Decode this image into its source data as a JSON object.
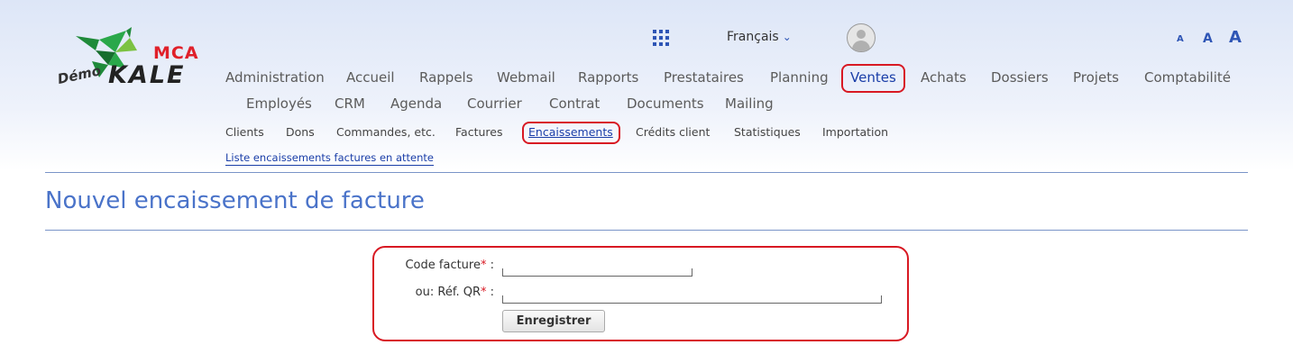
{
  "logo": {
    "brand_top": "MCA",
    "brand_main": "KALE",
    "demo": "Démo"
  },
  "header": {
    "language": "Français",
    "font_sizes": [
      "A",
      "A",
      "A"
    ]
  },
  "nav": {
    "row1": [
      "Administration",
      "Accueil",
      "Rappels",
      "Webmail",
      "Rapports",
      "Prestataires",
      "Planning",
      "Ventes",
      "Achats",
      "Dossiers",
      "Projets",
      "Comptabilité"
    ],
    "row2": [
      "Employés",
      "CRM",
      "Agenda",
      "Courrier",
      "Contrat",
      "Documents",
      "Mailing"
    ],
    "active": "Ventes"
  },
  "subnav": {
    "items": [
      "Clients",
      "Dons",
      "Commandes, etc.",
      "Factures",
      "Encaissements",
      "Crédits client",
      "Statistiques",
      "Importation"
    ],
    "active": "Encaissements",
    "sublink": "Liste encaissements factures en attente"
  },
  "page": {
    "title": "Nouvel encaissement de facture"
  },
  "form": {
    "code_label": "Code facture",
    "ref_label": "ou: Réf. QR",
    "required_mark": "*",
    "separator": " :",
    "code_value": "",
    "ref_value": "",
    "submit_label": "Enregistrer"
  },
  "colors": {
    "accent": "#1a3ea8",
    "highlight": "#d81923",
    "title": "#4a73c9"
  }
}
